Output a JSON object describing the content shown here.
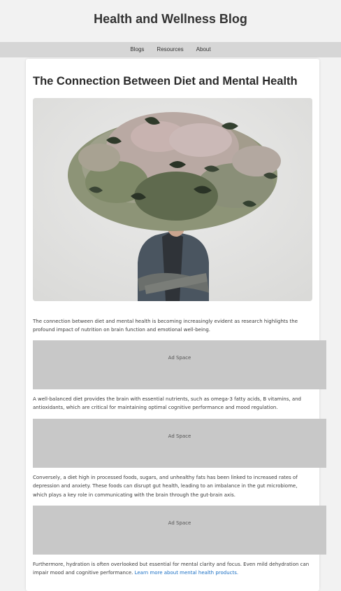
{
  "site": {
    "title": "Health and Wellness Blog"
  },
  "nav": {
    "items": [
      {
        "label": "Blogs"
      },
      {
        "label": "Resources"
      },
      {
        "label": "About"
      }
    ]
  },
  "article": {
    "title": "The Connection Between Diet and Mental Health",
    "hero_image": "person-with-flower-bouquet-head-photo",
    "paragraphs": [
      {
        "text": "The connection between diet and mental health is becoming increasingly evident as research highlights the profound impact of nutrition on brain function and emotional well-being."
      },
      {
        "text": "A well-balanced diet provides the brain with essential nutrients, such as omega-3 fatty acids, B vitamins, and antioxidants, which are critical for maintaining optimal cognitive performance and mood regulation."
      },
      {
        "text": "Conversely, a diet high in processed foods, sugars, and unhealthy fats has been linked to increased rates of depression and anxiety. These foods can disrupt gut health, leading to an imbalance in the gut microbiome, which plays a key role in communicating with the brain through the gut-brain axis."
      },
      {
        "text": "Furthermore, hydration is often overlooked but essential for mental clarity and focus. Even mild dehydration can impair mood and cognitive performance. ",
        "link": "Learn more about mental health products."
      }
    ],
    "ads": [
      {
        "label": "Ad Space"
      },
      {
        "label": "Ad Space"
      },
      {
        "label": "Ad Space"
      }
    ]
  },
  "colors": {
    "page_background": "#f2f2f2",
    "nav_background": "#d6d6d6",
    "card_background": "#ffffff",
    "ad_background": "#c8c8c8",
    "link": "#1a6fc4"
  }
}
